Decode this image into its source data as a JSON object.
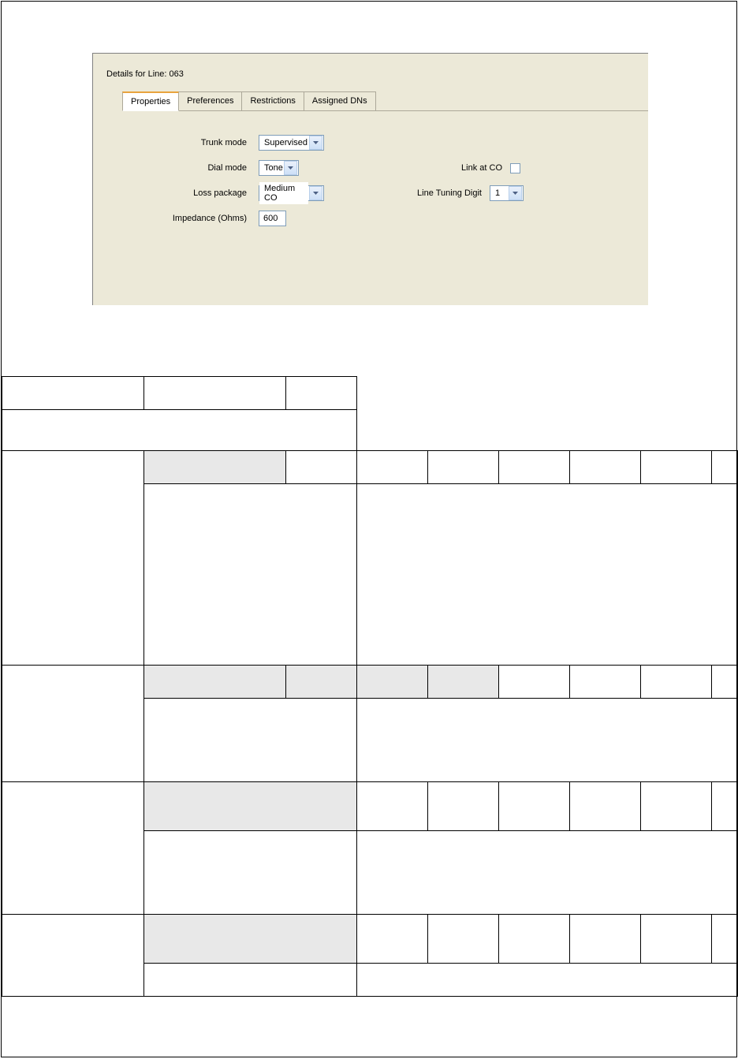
{
  "panel": {
    "title": "Details for Line: 063",
    "tabs": [
      {
        "label": "Properties",
        "active": true
      },
      {
        "label": "Preferences",
        "active": false
      },
      {
        "label": "Restrictions",
        "active": false
      },
      {
        "label": "Assigned DNs",
        "active": false
      }
    ],
    "form": {
      "trunk_mode": {
        "label": "Trunk mode",
        "value": "Supervised"
      },
      "dial_mode": {
        "label": "Dial mode",
        "value": "Tone"
      },
      "loss_package": {
        "label": "Loss package",
        "value": "Medium CO"
      },
      "impedance": {
        "label": "Impedance (Ohms)",
        "value": "600"
      },
      "link_at_co": {
        "label": "Link at CO",
        "checked": false
      },
      "line_tuning_digit": {
        "label": "Line Tuning Digit",
        "value": "1"
      }
    }
  }
}
